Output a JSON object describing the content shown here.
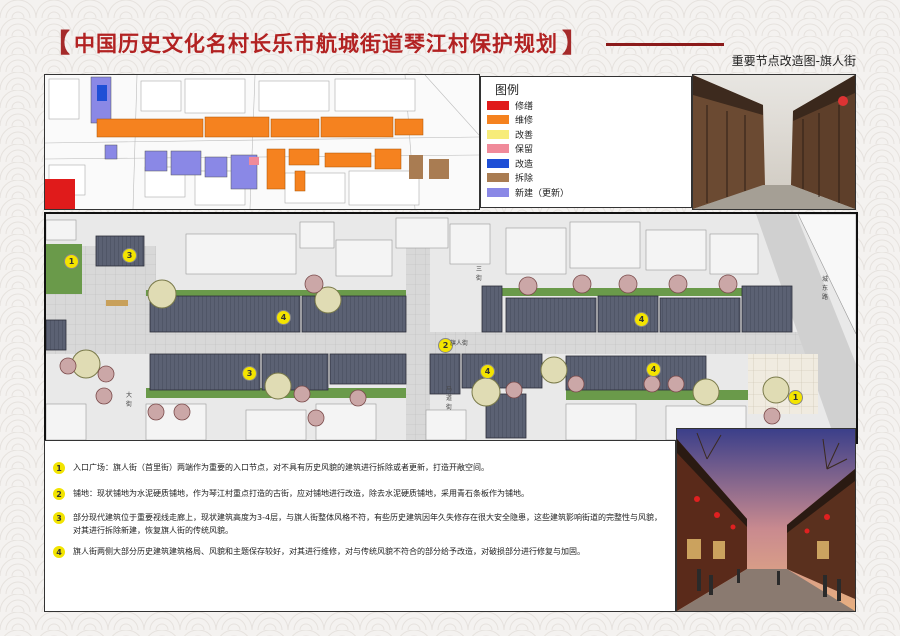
{
  "header": {
    "bracket_left": "【",
    "title": "中国历史文化名村长乐市航城街道琴江村保护规划",
    "bracket_right": "】",
    "subtitle": "重要节点改造图-旗人街"
  },
  "legend": {
    "title": "图例",
    "items": [
      {
        "label": "修缮",
        "color": "#e01b1b"
      },
      {
        "label": "维修",
        "color": "#f5821f"
      },
      {
        "label": "改善",
        "color": "#f7ec7a"
      },
      {
        "label": "保留",
        "color": "#f08a9a"
      },
      {
        "label": "改造",
        "color": "#1f4fd6"
      },
      {
        "label": "拆除",
        "color": "#a97c52"
      },
      {
        "label": "新建（更新）",
        "color": "#8a88e6"
      }
    ]
  },
  "plan_labels": {
    "marker_1": "1",
    "marker_2": "2",
    "marker_3": "3",
    "marker_4": "4",
    "street_1": "三街",
    "street_2": "旗人街",
    "street_3": "马道街",
    "street_4": "大街",
    "street_5": "城东路"
  },
  "notes": [
    {
      "num": "1",
      "text": "入口广场：旗人街（首里街）两端作为重要的入口节点，对不具有历史风貌的建筑进行拆除或者更新，打造开敞空间。"
    },
    {
      "num": "2",
      "text": "铺地：现状铺地为水泥硬质铺地，作为琴江村重点打造的古街，应对铺地进行改造，除去水泥硬质铺地，采用青石条板作为铺地。"
    },
    {
      "num": "3",
      "text": "部分现代建筑位于重要视线走廊上，现状建筑高度为3-4层，与旗人街整体风格不符，有些历史建筑因年久失修存在很大安全隐患，这些建筑影响街道的完整性与风貌，对其进行拆除新建，恢复旗人街的传统风貌。"
    },
    {
      "num": "4",
      "text": "旗人街两侧大部分历史建筑建筑格局、风貌和主题保存较好，对其进行维修，对与传统风貌不符合的部分给予改造，对破损部分进行修复与加固。"
    }
  ]
}
